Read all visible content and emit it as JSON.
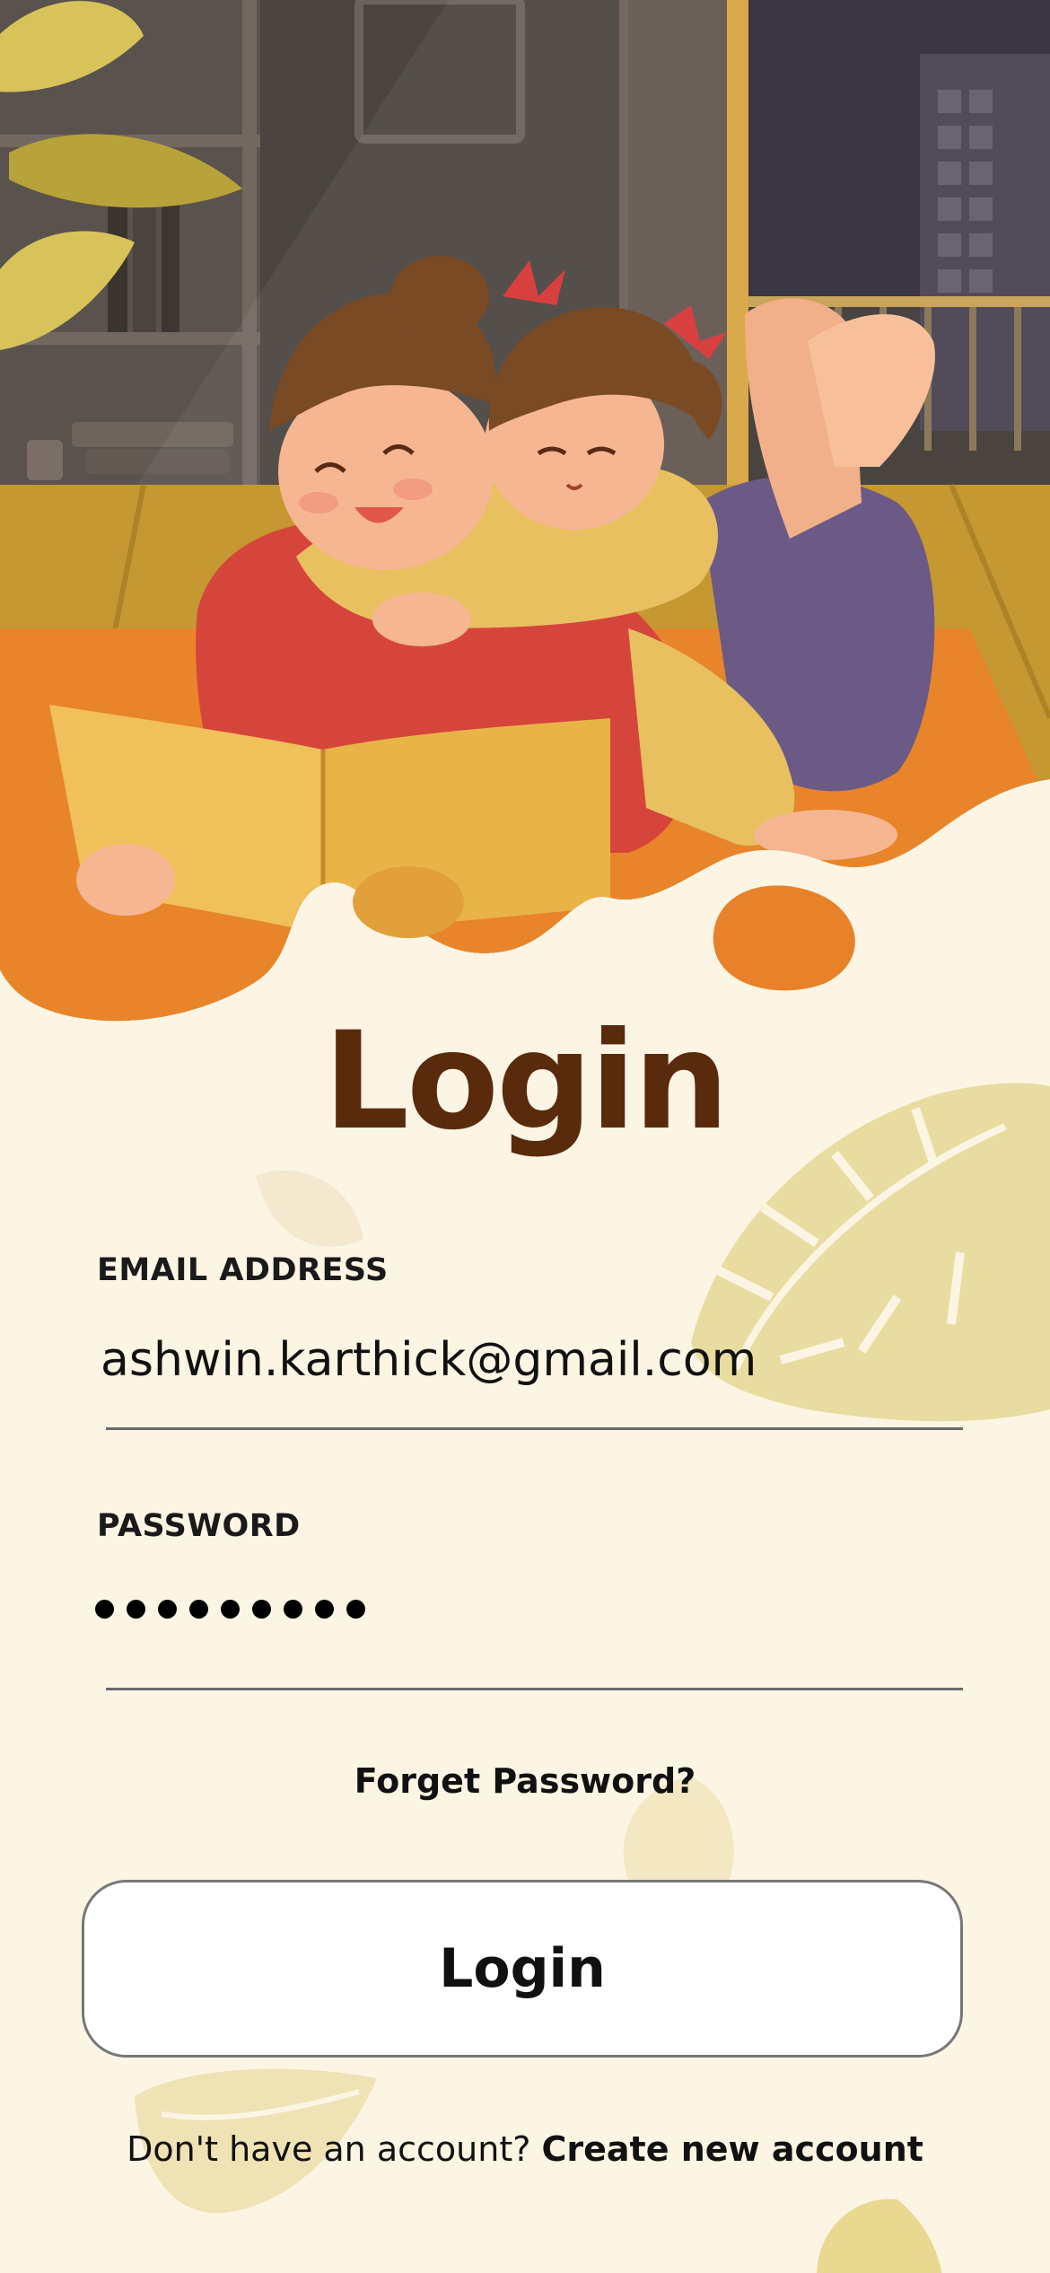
{
  "page_title": "Login",
  "email": {
    "label": "EMAIL ADDRESS",
    "value": "ashwin.karthick@gmail.com"
  },
  "password": {
    "label": "PASSWORD",
    "masked_length": 9
  },
  "forgot_label": "Forget Password?",
  "login_button_label": "Login",
  "signup": {
    "prompt": "Don't have an account?",
    "link_label": "Create new account"
  },
  "colors": {
    "background": "#fdf5e4",
    "title": "#5a2a0c",
    "leaf": "#e8dca0",
    "accent_orange": "#e8822a"
  },
  "illustration": {
    "subject": "mother-and-daughter-reading-book"
  }
}
